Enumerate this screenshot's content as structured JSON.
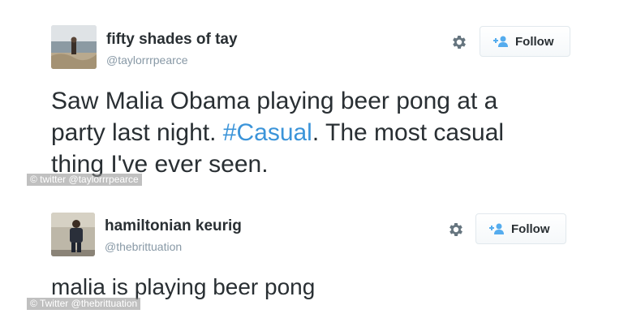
{
  "tweets": [
    {
      "author_name": "fifty shades of tay",
      "author_handle": "@taylorrrpearce",
      "follow_label": "Follow",
      "text_part1": "Saw Malia Obama playing beer pong at a",
      "text_part2": "party last night. ",
      "hashtag": "#Casual",
      "text_part3": ". The most casual",
      "text_part4": "thing I've ever seen.",
      "credit": "© twitter @taylorrrpearce"
    },
    {
      "author_name": "hamiltonian keurig",
      "author_handle": "@thebrittuation",
      "follow_label": "Follow",
      "text": "malia is playing beer pong",
      "credit": "© Twitter @thebrittuation"
    }
  ],
  "icons": [
    "gear-icon",
    "add-user-icon"
  ],
  "colors": {
    "name": "#292f33",
    "handle": "#8899a6",
    "hashtag": "#3b94d9",
    "follow_icon": "#55acee",
    "button_border": "#e1e8ed"
  }
}
